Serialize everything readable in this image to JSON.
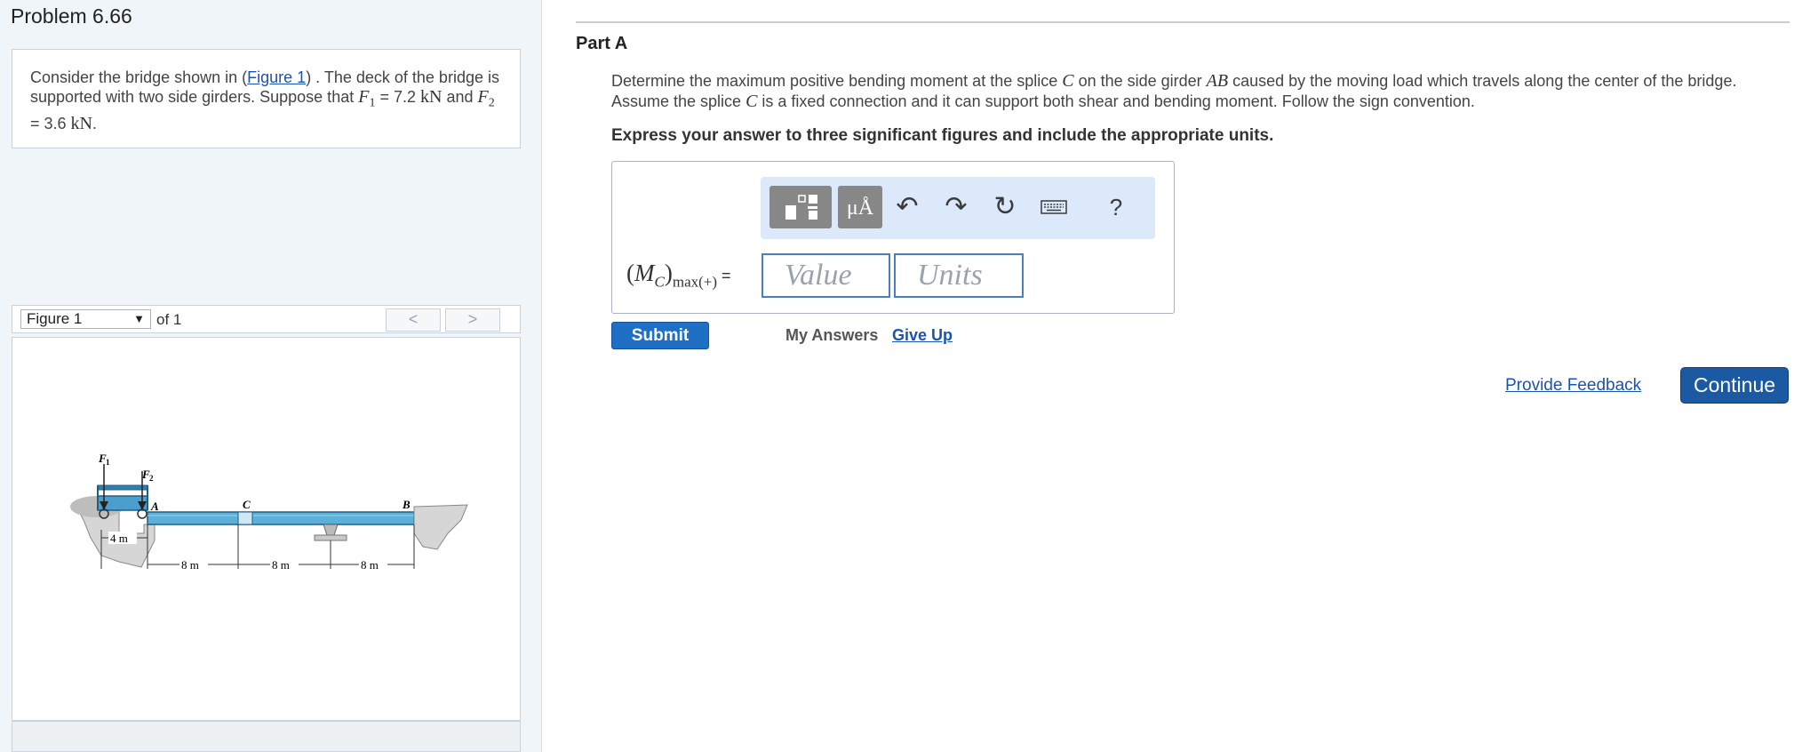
{
  "problem": {
    "title": "Problem 6.66",
    "text_before_link": "Consider the bridge shown in (",
    "link": "Figure 1",
    "text_after_link": ") . The deck of the bridge is supported with two side girders. Suppose that ",
    "f1_symbol": "F",
    "f1_sub": "1",
    "f1_eq": " = ",
    "f1_value": "7.2",
    "f1_unit": "kN",
    "and": " and ",
    "f2_symbol": "F",
    "f2_sub": "2",
    "f2_eq": " = 3.6 ",
    "f2_unit": "kN",
    "end": "."
  },
  "figure_nav": {
    "selected": "Figure 1",
    "of": "of 1",
    "prev": "<",
    "next": ">"
  },
  "figure": {
    "labels": {
      "F1": "F",
      "F1_sub": "1",
      "F2": "F",
      "F2_sub": "2",
      "A": "A",
      "C": "C",
      "B": "B",
      "dim_4m": "4 m",
      "dim_8m_1": "8 m",
      "dim_8m_2": "8 m",
      "dim_8m_3": "8 m"
    }
  },
  "part": {
    "title": "Part A",
    "q1": "Determine the maximum positive bending moment at the splice ",
    "q_c": "C",
    "q2": " on the side girder ",
    "q_ab": "AB",
    "q3": " caused by the moving load which travels along the center of the bridge. Assume the splice ",
    "q_c2": "C",
    "q4": " is a fixed connection and it can support both shear and bending moment. Follow the sign convention.",
    "instruction": "Express your answer to three significant figures and include the appropriate units."
  },
  "answer": {
    "label_open": "(",
    "label_m": "M",
    "label_c": "C",
    "label_close": ")",
    "label_sub": "max(+)",
    "label_eq": " =",
    "value_placeholder": "Value",
    "units_placeholder": "Units",
    "toolbar": {
      "templates_icon": "templates-icon",
      "units_label": "μÅ",
      "help_label": "?"
    }
  },
  "actions": {
    "submit": "Submit",
    "my_answers": "My Answers",
    "give_up": "Give Up",
    "feedback": "Provide Feedback",
    "continue": "Continue"
  },
  "colors": {
    "accent": "#1f6fc5",
    "continue": "#1b5aa3",
    "link": "#1a54b3",
    "toolbar_bg": "#dbe9fa",
    "girder": "#5ab0d8"
  }
}
